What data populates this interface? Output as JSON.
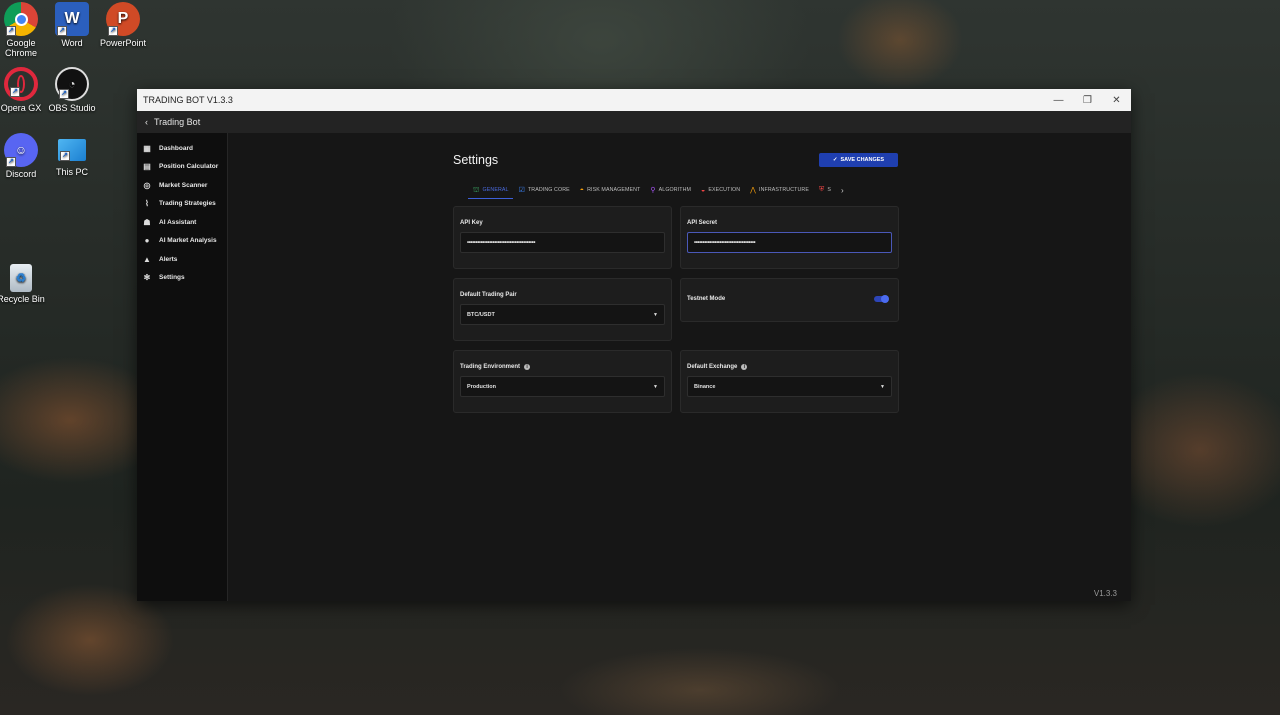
{
  "desktop": {
    "icons": [
      {
        "label": "Google Chrome",
        "icon": "chrome-icon"
      },
      {
        "label": "Word",
        "icon": "word-icon"
      },
      {
        "label": "PowerPoint",
        "icon": "powerpoint-icon"
      },
      {
        "label": "Opera GX",
        "icon": "opera-icon"
      },
      {
        "label": "OBS Studio",
        "icon": "obs-icon"
      },
      {
        "label": "Discord",
        "icon": "discord-icon"
      },
      {
        "label": "This PC",
        "icon": "pc-icon"
      },
      {
        "label": "Recycle Bin",
        "icon": "recycle-bin-icon"
      }
    ]
  },
  "window": {
    "title": "TRADING BOT V1.3.3",
    "back_label": "Trading Bot"
  },
  "sidebar": {
    "items": [
      {
        "label": "Dashboard",
        "icon": "grid-icon"
      },
      {
        "label": "Position Calculator",
        "icon": "calculator-icon"
      },
      {
        "label": "Market Scanner",
        "icon": "scanner-icon"
      },
      {
        "label": "Trading Strategies",
        "icon": "chart-icon"
      },
      {
        "label": "AI Assistant",
        "icon": "robot-icon"
      },
      {
        "label": "AI Market Analysis",
        "icon": "bulb-icon"
      },
      {
        "label": "Alerts",
        "icon": "bell-icon"
      },
      {
        "label": "Settings",
        "icon": "gear-icon"
      }
    ]
  },
  "main": {
    "title": "Settings",
    "save_label": "SAVE CHANGES",
    "tabs": [
      {
        "label": "GENERAL",
        "icon": "bank-icon",
        "color": "#3fb56a",
        "active": true
      },
      {
        "label": "TRADING CORE",
        "icon": "checkbox-icon",
        "color": "#3b82f6"
      },
      {
        "label": "RISK MANAGEMENT",
        "icon": "gauge-icon",
        "color": "#f59e0b"
      },
      {
        "label": "ALGORITHM",
        "icon": "pin-icon",
        "color": "#a855f7"
      },
      {
        "label": "EXECUTION",
        "icon": "speed-icon",
        "color": "#ef4444"
      },
      {
        "label": "INFRASTRUCTURE",
        "icon": "signal-icon",
        "color": "#f59e0b"
      },
      {
        "label": "S",
        "icon": "shield-icon",
        "color": "#ef4444"
      }
    ],
    "api_key": {
      "label": "API Key",
      "value": "••••••••••••••••••••••••••••••••••••••••"
    },
    "api_secret": {
      "label": "API Secret",
      "value": "••••••••••••••••••••••••••••••••••••"
    },
    "default_pair": {
      "label": "Default Trading Pair",
      "value": "BTC/USDT"
    },
    "testnet": {
      "label": "Testnet Mode",
      "enabled": true
    },
    "environment": {
      "label": "Trading Environment",
      "value": "Production"
    },
    "exchange": {
      "label": "Default Exchange",
      "value": "Binance"
    }
  },
  "footer": {
    "version": "V1.3.3"
  },
  "colors": {
    "accent": "#1f3fb0",
    "background": "#161616",
    "card": "#1d1d1d"
  }
}
